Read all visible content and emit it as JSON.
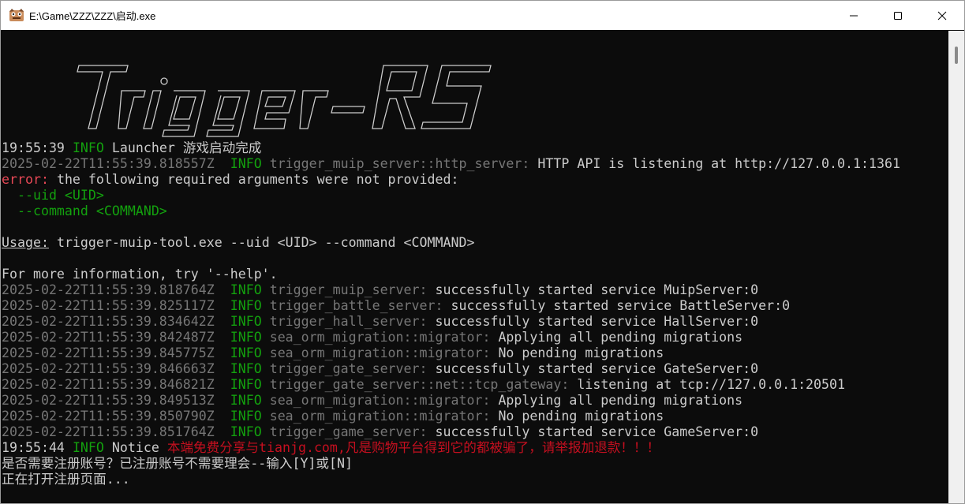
{
  "window": {
    "title": "E:\\Game\\ZZZ\\ZZZ\\启动.exe",
    "icons": {
      "app": "app-icon",
      "minimize": "minimize-icon",
      "maximize": "maximize-icon",
      "close": "close-icon"
    }
  },
  "colors": {
    "background": "#0c0c0c",
    "text": "#cccccc",
    "timestamp": "#767676",
    "info": "#13a10e",
    "error": "#e74856",
    "notice": "#c50f1f"
  },
  "banner": {
    "ascii_logo_text": "Trigger-RS"
  },
  "console": {
    "launcher": {
      "time": "19:55:39",
      "level": "INFO",
      "message": "Launcher 游戏启动完成"
    },
    "http": {
      "time": "2025-02-22T11:55:39.818557Z",
      "level": "INFO",
      "target": "trigger_muip_server::http_server:",
      "message": "HTTP API is listening at http://127.0.0.1:1361"
    },
    "error": {
      "label": "error:",
      "message": "the following required arguments were not provided:",
      "arg1": "--uid <UID>",
      "arg2": "--command <COMMAND>",
      "usage_label": "Usage:",
      "usage": "trigger-muip-tool.exe --uid <UID> --command <COMMAND>",
      "help": "For more information, try '--help'."
    },
    "logs": [
      {
        "time": "2025-02-22T11:55:39.818764Z",
        "level": "INFO",
        "target": "trigger_muip_server:",
        "message": "successfully started service MuipServer:0"
      },
      {
        "time": "2025-02-22T11:55:39.825117Z",
        "level": "INFO",
        "target": "trigger_battle_server:",
        "message": "successfully started service BattleServer:0"
      },
      {
        "time": "2025-02-22T11:55:39.834642Z",
        "level": "INFO",
        "target": "trigger_hall_server:",
        "message": "successfully started service HallServer:0"
      },
      {
        "time": "2025-02-22T11:55:39.842487Z",
        "level": "INFO",
        "target": "sea_orm_migration::migrator:",
        "message": "Applying all pending migrations"
      },
      {
        "time": "2025-02-22T11:55:39.845775Z",
        "level": "INFO",
        "target": "sea_orm_migration::migrator:",
        "message": "No pending migrations"
      },
      {
        "time": "2025-02-22T11:55:39.846663Z",
        "level": "INFO",
        "target": "trigger_gate_server:",
        "message": "successfully started service GateServer:0"
      },
      {
        "time": "2025-02-22T11:55:39.846821Z",
        "level": "INFO",
        "target": "trigger_gate_server::net::tcp_gateway:",
        "message": "listening at tcp://127.0.0.1:20501"
      },
      {
        "time": "2025-02-22T11:55:39.849513Z",
        "level": "INFO",
        "target": "sea_orm_migration::migrator:",
        "message": "Applying all pending migrations"
      },
      {
        "time": "2025-02-22T11:55:39.850790Z",
        "level": "INFO",
        "target": "sea_orm_migration::migrator:",
        "message": "No pending migrations"
      },
      {
        "time": "2025-02-22T11:55:39.851764Z",
        "level": "INFO",
        "target": "trigger_game_server:",
        "message": "successfully started service GameServer:0"
      }
    ],
    "notice": {
      "time": "19:55:44",
      "level": "INFO",
      "label": "Notice",
      "message": "本端免费分享与tianjg.com,凡是购物平台得到它的都被骗了，请举报加退款！！！"
    },
    "prompt": "是否需要注册账号？已注册账号不需要理会--输入[Y]或[N]",
    "opening": "正在打开注册页面..."
  }
}
